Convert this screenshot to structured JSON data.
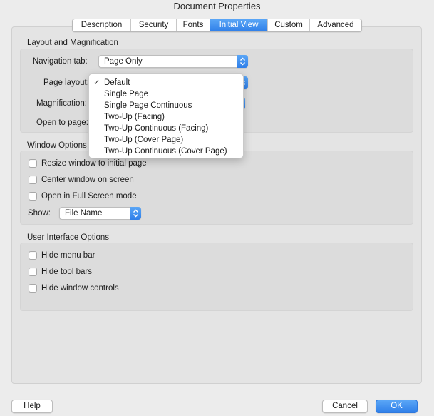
{
  "window": {
    "title": "Document Properties"
  },
  "tabs": [
    {
      "label": "Description",
      "active": false
    },
    {
      "label": "Security",
      "active": false
    },
    {
      "label": "Fonts",
      "active": false
    },
    {
      "label": "Initial View",
      "active": true
    },
    {
      "label": "Custom",
      "active": false
    },
    {
      "label": "Advanced",
      "active": false
    }
  ],
  "layout_section": {
    "title": "Layout and Magnification",
    "navigation_tab": {
      "label": "Navigation tab:",
      "value": "Page Only"
    },
    "page_layout": {
      "label": "Page layout:"
    },
    "magnification": {
      "label": "Magnification:"
    },
    "open_to_page": {
      "label": "Open to page:"
    }
  },
  "page_layout_menu": {
    "selected": "Default",
    "options": [
      "Default",
      "Single Page",
      "Single Page Continuous",
      "Two-Up (Facing)",
      "Two-Up Continuous (Facing)",
      "Two-Up (Cover Page)",
      "Two-Up Continuous (Cover Page)"
    ]
  },
  "window_section": {
    "title": "Window Options",
    "checkboxes": [
      {
        "label": "Resize window to initial page",
        "checked": false
      },
      {
        "label": "Center window on screen",
        "checked": false
      },
      {
        "label": "Open in Full Screen mode",
        "checked": false
      }
    ],
    "show": {
      "label": "Show:",
      "value": "File Name"
    }
  },
  "ui_section": {
    "title": "User Interface Options",
    "checkboxes": [
      {
        "label": "Hide menu bar",
        "checked": false
      },
      {
        "label": "Hide tool bars",
        "checked": false
      },
      {
        "label": "Hide window controls",
        "checked": false
      }
    ]
  },
  "buttons": {
    "help": "Help",
    "cancel": "Cancel",
    "ok": "OK"
  },
  "colors": {
    "accent": "#2f7fe9",
    "background": "#ececec",
    "group": "#dcdcdc"
  }
}
